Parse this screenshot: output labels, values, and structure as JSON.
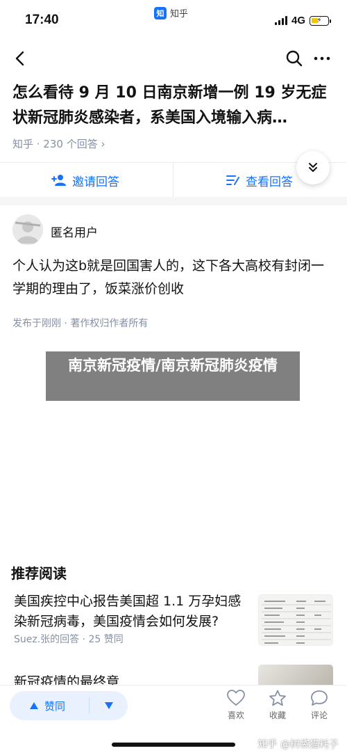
{
  "status_bar": {
    "time": "17:40",
    "app_badge": "知",
    "app_name": "知乎",
    "network": "4G"
  },
  "question": {
    "title": "怎么看待 9 月 10 日南京新增一例 19 岁无症状新冠肺炎感染者，系美国入境输入病…",
    "meta": "知乎 · 230 个回答 ›"
  },
  "actions": {
    "invite_label": "邀请回答",
    "view_label": "查看回答"
  },
  "answer": {
    "author": "匿名用户",
    "text": "个人认为这b就是回国害人的，这下各大高校有封闭一学期的理由了，饭菜涨价创收",
    "note": "发布于刚刚 · 著作权归作者所有"
  },
  "overlay_text": "南京新冠疫情/南京新冠肺炎疫情",
  "recommend": {
    "section_title": "推荐阅读",
    "items": [
      {
        "title": "美国疾控中心报告美国超 1.1 万孕妇感染新冠病毒，美国疫情会如何发展?",
        "meta": "Suez.张的回答 · 25 赞同"
      },
      {
        "title": "新冠疫情的最终章"
      }
    ]
  },
  "bottom_bar": {
    "vote_label": "赞同",
    "like_label": "喜欢",
    "fav_label": "收藏",
    "comment_label": "评论",
    "watermark": "知乎 @树袋猫耗子"
  },
  "colors": {
    "accent": "#1772f6",
    "meta_gray": "#8590a6",
    "overlay_bg": "#6e6e6e"
  },
  "icons": [
    "back-icon",
    "search-icon",
    "more-icon",
    "add-user-icon",
    "list-icon",
    "chevron-double-down-icon",
    "triangle-up-icon",
    "triangle-down-icon",
    "heart-icon",
    "star-icon",
    "comment-icon"
  ]
}
